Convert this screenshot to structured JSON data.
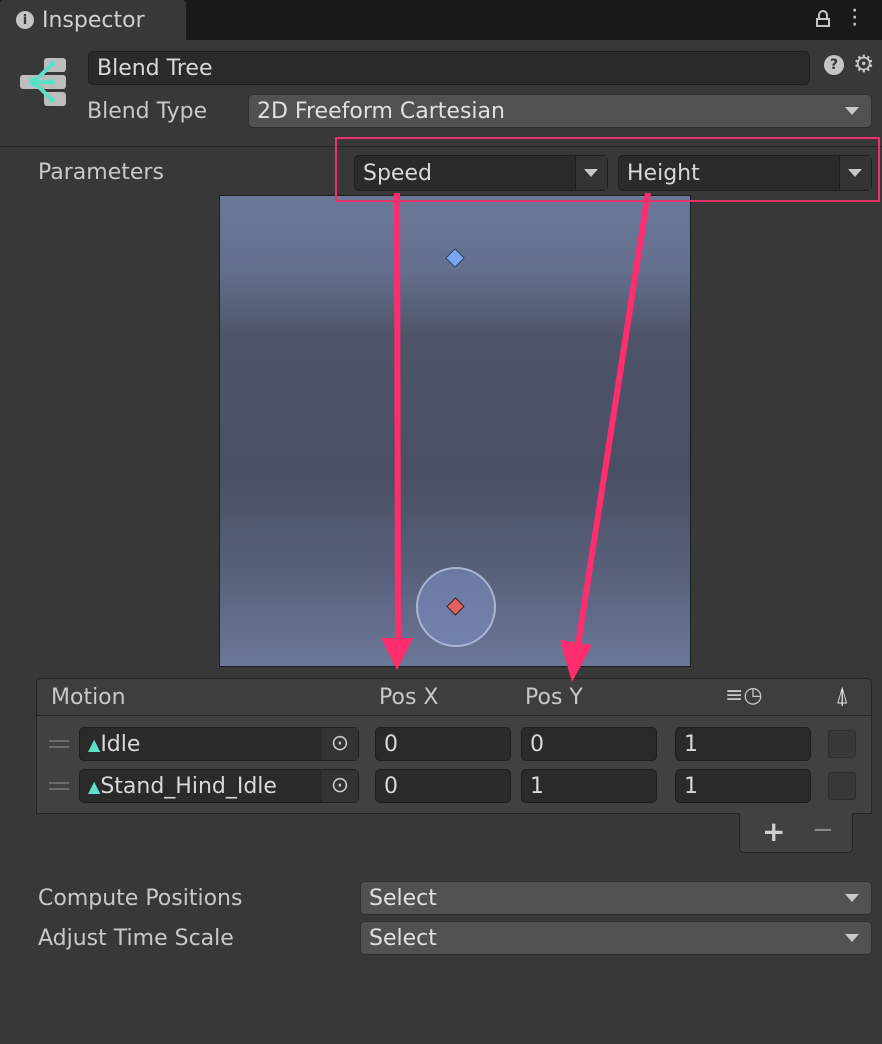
{
  "tab": {
    "title": "Inspector",
    "icon": "info-icon"
  },
  "header": {
    "name": "Blend Tree",
    "blend_type_label": "Blend Type",
    "blend_type": "2D Freeform Cartesian"
  },
  "parameters": {
    "label": "Parameters",
    "x_param": "Speed",
    "y_param": "Height"
  },
  "blend_space": {
    "points": [
      {
        "motion": "Idle",
        "x": 0,
        "y": 0,
        "selected": true
      },
      {
        "motion": "Stand_Hind_Idle",
        "x": 0,
        "y": 1
      }
    ]
  },
  "motion_table": {
    "headers": {
      "motion": "Motion",
      "pos_x": "Pos X",
      "pos_y": "Pos Y",
      "time_scale_icon": "clock-speed-icon",
      "mirror_icon": "mirror-icon"
    },
    "rows": [
      {
        "motion": "Idle",
        "pos_x": "0",
        "pos_y": "0",
        "speed": "1"
      },
      {
        "motion": "Stand_Hind_Idle",
        "pos_x": "0",
        "pos_y": "1",
        "speed": "1"
      }
    ]
  },
  "compute_positions": {
    "label": "Compute Positions",
    "value": "Select"
  },
  "adjust_time_scale": {
    "label": "Adjust Time Scale",
    "value": "Select"
  },
  "annotation_color": "#e8336a"
}
